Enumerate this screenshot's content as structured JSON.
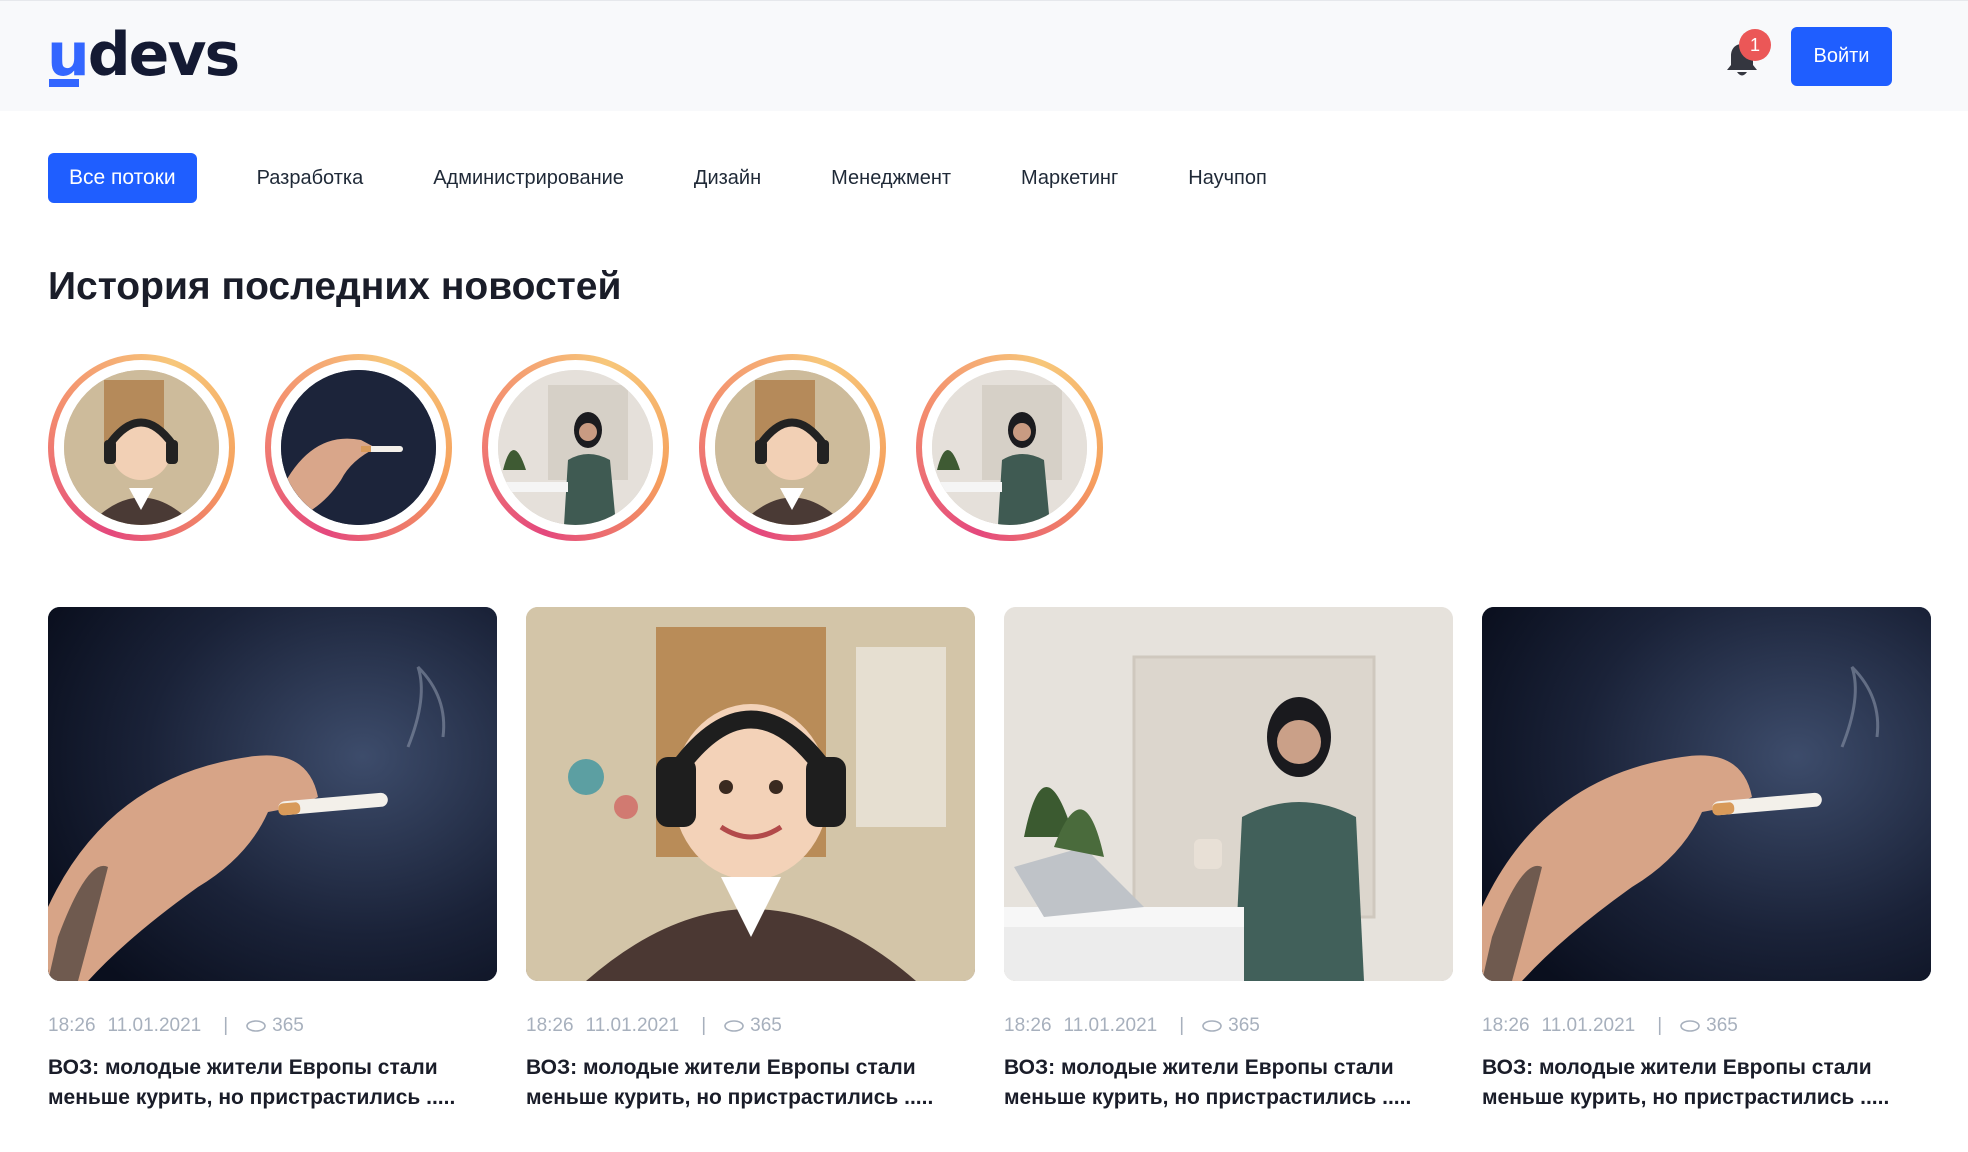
{
  "header": {
    "logo_text": "udevs",
    "logo_highlight": "u",
    "logo_rest": "devs",
    "notification_count": "1",
    "login_label": "Войти"
  },
  "tabs": [
    {
      "label": "Все потоки",
      "active": true
    },
    {
      "label": "Разработка"
    },
    {
      "label": "Администрирование"
    },
    {
      "label": "Дизайн"
    },
    {
      "label": "Менеджмент"
    },
    {
      "label": "Маркетинг"
    },
    {
      "label": "Научпоп"
    }
  ],
  "stories_title": "История последних новостей",
  "stories": [
    {
      "image": "girl-headphones"
    },
    {
      "image": "hand-cigarette"
    },
    {
      "image": "woman-hijab"
    },
    {
      "image": "girl-headphones"
    },
    {
      "image": "woman-hijab"
    }
  ],
  "cards": [
    {
      "image": "hand-cigarette",
      "time": "18:26",
      "date": "11.01.2021",
      "views": "365",
      "title": "ВОЗ: молодые жители Европы стали меньше курить, но пристрастились ....."
    },
    {
      "image": "girl-headphones",
      "time": "18:26",
      "date": "11.01.2021",
      "views": "365",
      "title": "ВОЗ: молодые жители Европы стали меньше курить, но пристрастились ....."
    },
    {
      "image": "woman-hijab",
      "time": "18:26",
      "date": "11.01.2021",
      "views": "365",
      "title": "ВОЗ: молодые жители Европы стали меньше курить, но пристрастились ....."
    },
    {
      "image": "hand-cigarette",
      "time": "18:26",
      "date": "11.01.2021",
      "views": "365",
      "title": "ВОЗ: молодые жители Европы стали меньше курить, но пристрастились ....."
    }
  ],
  "colors": {
    "accent": "#1f5eff",
    "badge": "#eb5757",
    "meta_text": "#a7b0bd"
  }
}
